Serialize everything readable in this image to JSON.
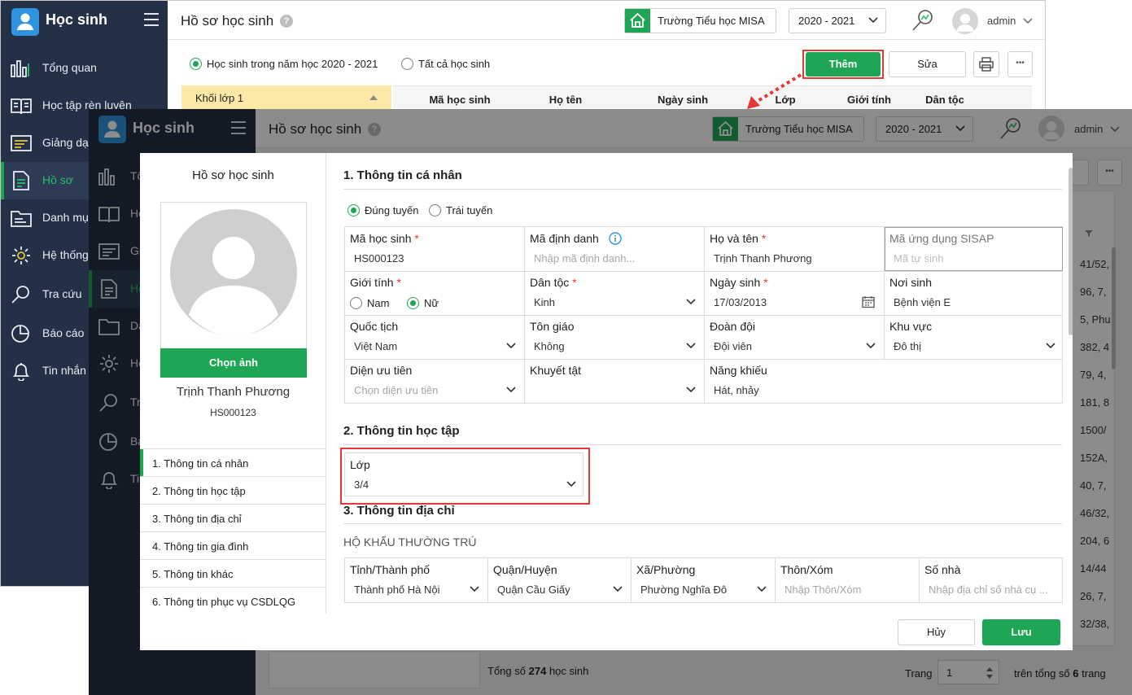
{
  "app": {
    "name": "Học sinh"
  },
  "nav": [
    {
      "label": "Tổng quan",
      "icon": "bar-chart-icon"
    },
    {
      "label": "Học tập rèn luyện",
      "icon": "book-icon"
    },
    {
      "label": "Giảng dạy",
      "icon": "slides-icon"
    },
    {
      "label": "Hồ sơ",
      "icon": "document-icon",
      "active": true
    },
    {
      "label": "Danh mục",
      "icon": "folder-icon"
    },
    {
      "label": "Hệ thống",
      "icon": "gear-icon"
    },
    {
      "label": "Tra cứu",
      "icon": "search-icon"
    },
    {
      "label": "Báo cáo",
      "icon": "pie-chart-icon"
    },
    {
      "label": "Tin nhắn",
      "icon": "bell-icon"
    }
  ],
  "nav_front_truncated": [
    "Tổ",
    "Họ",
    "Gi",
    "Hồ",
    "Da",
    "Hệ",
    "Tr",
    "Bá",
    "Tin"
  ],
  "header": {
    "title": "Hồ sơ học sinh",
    "help": "?",
    "school": "Trường Tiểu học MISA",
    "year": "2020 - 2021",
    "user": "admin"
  },
  "filters": {
    "opt1": "Học sinh trong năm học 2020 - 2021",
    "opt2": "Tất cả học sinh"
  },
  "toolbar": {
    "add": "Thêm",
    "edit": "Sửa",
    "more": "•••"
  },
  "left_panel": {
    "grade": "Khối lớp 1"
  },
  "table": {
    "headers": [
      "Mã học sinh",
      "Họ tên",
      "Ngày sinh",
      "Lớp",
      "Giới tính",
      "Dân tộc"
    ],
    "right_column": [
      "41/52,",
      "96, 7,",
      "5, Phu",
      "382, 4",
      "79, 4,",
      "181, 8",
      "1500/",
      "152A,",
      "40, 7,",
      "46/32,",
      "204, 6",
      "14/44",
      "26, 7,",
      "32/38,"
    ]
  },
  "footer": {
    "total_prefix": "Tổng số",
    "total_count": "274",
    "total_suffix": "học sinh",
    "page_label": "Trang",
    "page_value": "1",
    "of_prefix": "trên tổng số",
    "of_count": "6",
    "of_suffix": "trang"
  },
  "modal": {
    "title": "Hồ sơ học sinh",
    "choose_photo": "Chọn ảnh",
    "student_name": "Trịnh Thanh Phương",
    "student_code": "HS000123",
    "toc": [
      "1. Thông tin cá nhân",
      "2. Thông tin học tập",
      "3. Thông tin địa chỉ",
      "4. Thông tin gia đình",
      "5. Thông tin khác",
      "6. Thông tin phục vụ CSDLQG"
    ],
    "sec1": "1. Thông tin cá nhân",
    "enroll1": "Đúng tuyến",
    "enroll2": "Trái tuyến",
    "f_code_label": "Mã học sinh",
    "f_code_value": "HS000123",
    "f_id_label": "Mã định danh",
    "f_id_ph": "Nhập mã định danh...",
    "f_name_label": "Họ và tên",
    "f_name_value": "Trịnh Thanh Phương",
    "f_sisap_label": "Mã ứng dụng SISAP",
    "f_sisap_ph": "Mã tự sinh",
    "f_gender_label": "Giới tính",
    "f_gender_m": "Nam",
    "f_gender_f": "Nữ",
    "f_ethnic_label": "Dân tộc",
    "f_ethnic_value": "Kinh",
    "f_dob_label": "Ngày sinh",
    "f_dob_value": "17/03/2013",
    "f_pob_label": "Nơi sinh",
    "f_pob_value": "Bệnh viện E",
    "f_nat_label": "Quốc tịch",
    "f_nat_value": "Việt Nam",
    "f_rel_label": "Tôn giáo",
    "f_rel_value": "Không",
    "f_team_label": "Đoàn đội",
    "f_team_value": "Đội viên",
    "f_area_label": "Khu vực",
    "f_area_value": "Đô thị",
    "f_prio_label": "Diện ưu tiên",
    "f_prio_ph": "Chọn diện ưu tiên",
    "f_dis_label": "Khuyết tật",
    "f_tal_label": "Năng khiếu",
    "f_tal_value": "Hát, nhảy",
    "sec2": "2. Thông tin học tập",
    "f_class_label": "Lớp",
    "f_class_value": "3/4",
    "sec3": "3. Thông tin địa chỉ",
    "sub3": "HỘ KHẨU THƯỜNG TRÚ",
    "f_prov_label": "Tỉnh/Thành phố",
    "f_prov_value": "Thành phố Hà Nội",
    "f_dist_label": "Quận/Huyện",
    "f_dist_value": "Quận Cầu Giấy",
    "f_ward_label": "Xã/Phường",
    "f_ward_value": "Phường Nghĩa Đô",
    "f_hamlet_label": "Thôn/Xóm",
    "f_hamlet_ph": "Nhập Thôn/Xóm",
    "f_house_label": "Số nhà",
    "f_house_ph": "Nhập địa chỉ số nhà cụ ...",
    "cancel": "Hủy",
    "save": "Lưu"
  },
  "colors": {
    "brand_green": "#1fa655",
    "sidebar": "#233046",
    "highlight": "#e53935"
  }
}
